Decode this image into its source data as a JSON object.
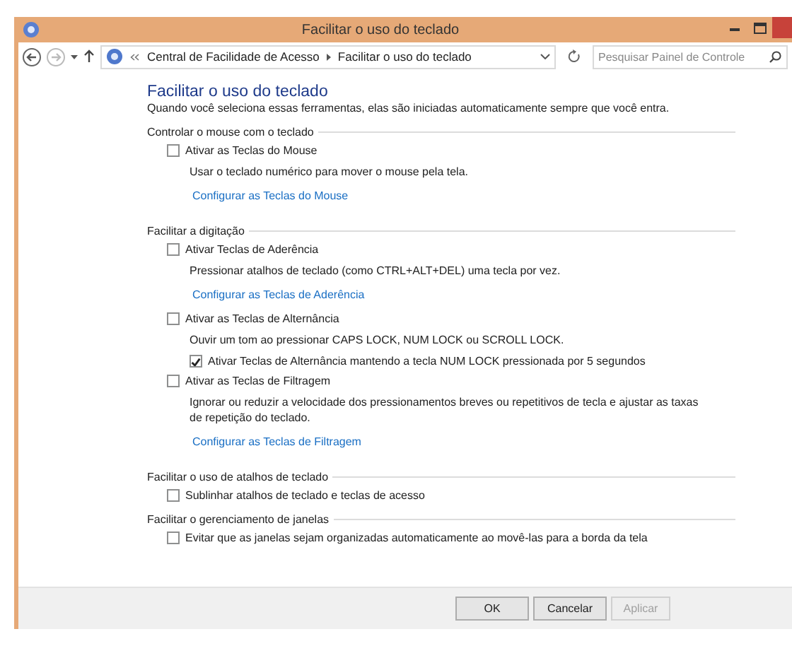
{
  "window": {
    "title": "Facilitar o uso do teclado"
  },
  "address_bar": {
    "breadcrumbs": [
      "Central de Facilidade de Acesso",
      "Facilitar o uso do teclado"
    ],
    "search": {
      "placeholder": "Pesquisar Painel de Controle"
    }
  },
  "page": {
    "heading": "Facilitar o uso do teclado",
    "description": "Quando você seleciona essas ferramentas, elas são iniciadas automaticamente sempre que você entra."
  },
  "sections": [
    {
      "title": "Controlar o mouse com o teclado",
      "items": [
        {
          "kind": "checkbox",
          "label": "Ativar as Teclas do Mouse",
          "checked": false
        },
        {
          "kind": "text",
          "text": "Usar o teclado numérico para mover o mouse pela tela."
        },
        {
          "kind": "link",
          "label": "Configurar as Teclas do Mouse"
        }
      ]
    },
    {
      "title": "Facilitar a digitação",
      "items": [
        {
          "kind": "checkbox",
          "label": "Ativar Teclas de Aderência",
          "checked": false
        },
        {
          "kind": "text",
          "text": "Pressionar atalhos de teclado (como CTRL+ALT+DEL) uma tecla por vez."
        },
        {
          "kind": "link",
          "label": "Configurar as Teclas de Aderência"
        },
        {
          "kind": "checkbox",
          "label": "Ativar as Teclas de Alternância",
          "checked": false
        },
        {
          "kind": "text",
          "text": "Ouvir um tom ao pressionar CAPS LOCK, NUM LOCK ou SCROLL LOCK."
        },
        {
          "kind": "subcheckbox",
          "label": "Ativar Teclas de Alternância mantendo a tecla NUM LOCK pressionada por 5 segundos",
          "checked": true
        },
        {
          "kind": "checkbox",
          "label": "Ativar as Teclas de Filtragem",
          "checked": false
        },
        {
          "kind": "text",
          "text": "Ignorar ou reduzir a velocidade dos pressionamentos breves ou repetitivos de tecla e ajustar as taxas de repetição do teclado."
        },
        {
          "kind": "link",
          "label": "Configurar as Teclas de Filtragem"
        }
      ]
    },
    {
      "title": "Facilitar o uso de atalhos de teclado",
      "items": [
        {
          "kind": "checkbox",
          "label": "Sublinhar atalhos de teclado e teclas de acesso",
          "checked": false
        }
      ]
    },
    {
      "title": "Facilitar o gerenciamento de janelas",
      "items": [
        {
          "kind": "checkbox",
          "label": "Evitar que as janelas sejam organizadas automaticamente ao movê-las para a borda da tela",
          "checked": false
        }
      ]
    }
  ],
  "buttons": [
    {
      "label": "OK",
      "disabled": false
    },
    {
      "label": "Cancelar",
      "disabled": false
    },
    {
      "label": "Aplicar",
      "disabled": true
    }
  ]
}
